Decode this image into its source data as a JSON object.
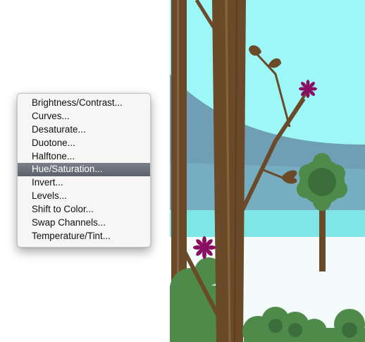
{
  "menu": {
    "items": [
      {
        "label": "Brightness/Contrast...",
        "selected": false
      },
      {
        "label": "Curves...",
        "selected": false
      },
      {
        "label": "Desaturate...",
        "selected": false
      },
      {
        "label": "Duotone...",
        "selected": false
      },
      {
        "label": "Halftone...",
        "selected": false
      },
      {
        "label": "Hue/Saturation...",
        "selected": true
      },
      {
        "label": "Invert...",
        "selected": false
      },
      {
        "label": "Levels...",
        "selected": false
      },
      {
        "label": "Shift to Color...",
        "selected": false
      },
      {
        "label": "Swap Channels...",
        "selected": false
      },
      {
        "label": "Temperature/Tint...",
        "selected": false
      }
    ]
  },
  "colors": {
    "selection": "#61666f",
    "sky": "#9ef7f7",
    "hill": "#6f9fb5",
    "trunk": "#6b4a2a",
    "foliage": "#4e8a4a",
    "flower": "#8a0f62"
  },
  "icons": [
    "flower-icon",
    "leaf-icon",
    "tree-icon"
  ]
}
